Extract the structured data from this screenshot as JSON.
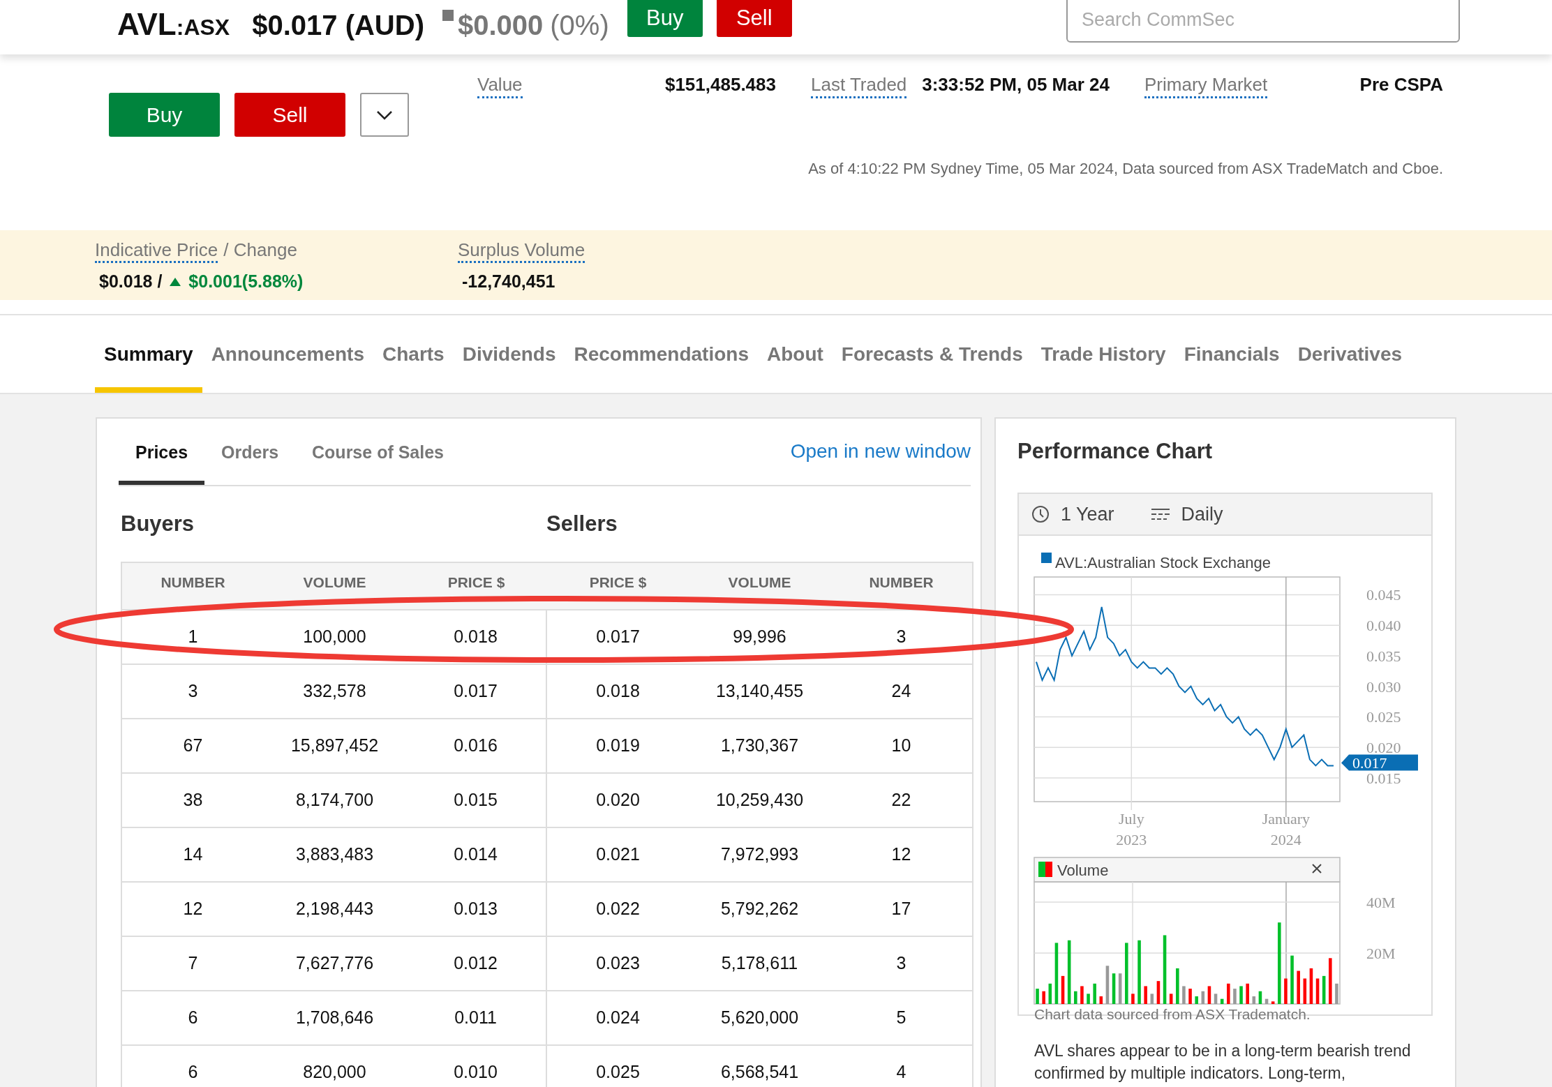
{
  "sticky_header": {
    "symbol": "AVL",
    "exchange": ":ASX",
    "price": "$0.017 (AUD)",
    "change": "$0.000",
    "change_pct": "(0%)",
    "buttons": [
      {
        "label": "Buy",
        "kind": "buy"
      },
      {
        "label": "Sell",
        "kind": "sell"
      }
    ],
    "search": {
      "placeholder": "Search CommSec"
    }
  },
  "actions": [
    {
      "label": "Buy",
      "kind": "buy"
    },
    {
      "label": "Sell",
      "kind": "sell"
    },
    {
      "kind": "menu"
    }
  ],
  "stats": [
    {
      "label": "Value",
      "value": "$151,485.483"
    },
    {
      "label": "Last Traded",
      "value": "3:33:52 PM, 05 Mar 24"
    },
    {
      "label": "Primary Market",
      "value": "Pre CSPA"
    }
  ],
  "as_of": "As of 4:10:22 PM Sydney Time, 05 Mar 2024, Data sourced from ASX TradeMatch and Cboe.",
  "auction": {
    "price_label": "Indicative Price",
    "change_label": "/ Change",
    "price": "$0.018 /",
    "change": "$0.001(5.88%)",
    "surplus_label": "Surplus Volume",
    "surplus": "-12,740,451"
  },
  "tabs": [
    {
      "label": "Summary",
      "selected": true
    },
    {
      "label": "Announcements",
      "selected": false
    },
    {
      "label": "Charts",
      "selected": false
    },
    {
      "label": "Dividends",
      "selected": false
    },
    {
      "label": "Recommendations",
      "selected": false
    },
    {
      "label": "About",
      "selected": false
    },
    {
      "label": "Forecasts & Trends",
      "selected": false
    },
    {
      "label": "Trade History",
      "selected": false
    },
    {
      "label": "Financials",
      "selected": false
    },
    {
      "label": "Derivatives",
      "selected": false
    }
  ],
  "depth": {
    "subtabs": [
      {
        "label": "Prices",
        "selected": true
      },
      {
        "label": "Orders",
        "selected": false
      },
      {
        "label": "Course of Sales",
        "selected": false
      }
    ],
    "open_link": "Open in new window",
    "buyers_title": "Buyers",
    "sellers_title": "Sellers",
    "columns": [
      "NUMBER",
      "VOLUME",
      "PRICE $",
      "PRICE $",
      "VOLUME",
      "NUMBER"
    ],
    "rows": [
      [
        "1",
        "100,000",
        "0.018",
        "0.017",
        "99,996",
        "3"
      ],
      [
        "3",
        "332,578",
        "0.017",
        "0.018",
        "13,140,455",
        "24"
      ],
      [
        "67",
        "15,897,452",
        "0.016",
        "0.019",
        "1,730,367",
        "10"
      ],
      [
        "38",
        "8,174,700",
        "0.015",
        "0.020",
        "10,259,430",
        "22"
      ],
      [
        "14",
        "3,883,483",
        "0.014",
        "0.021",
        "7,972,993",
        "12"
      ],
      [
        "12",
        "2,198,443",
        "0.013",
        "0.022",
        "5,792,262",
        "17"
      ],
      [
        "7",
        "7,627,776",
        "0.012",
        "0.023",
        "5,178,611",
        "3"
      ],
      [
        "6",
        "1,708,646",
        "0.011",
        "0.024",
        "5,620,000",
        "5"
      ],
      [
        "6",
        "820,000",
        "0.010",
        "0.025",
        "6,568,541",
        "4"
      ]
    ]
  },
  "annotation": {
    "kind": "ellipse",
    "color": "#ee3a33"
  },
  "performance": {
    "title": "Performance Chart",
    "period": "1 Year",
    "interval": "Daily",
    "last_price": "0.017",
    "chart_data": {
      "type": "line",
      "grid": true,
      "categories": [
        null,
        null,
        null,
        null,
        null,
        null,
        null,
        null,
        null,
        null,
        null,
        null,
        null,
        null,
        null,
        null,
        "July 2023",
        null,
        null,
        null,
        null,
        null,
        null,
        null,
        null,
        null,
        null,
        null,
        null,
        null,
        null,
        null,
        null,
        null,
        null,
        null,
        null,
        null,
        null,
        null,
        null,
        null,
        "January 2024",
        null,
        null,
        null,
        null,
        null,
        null,
        null,
        null
      ],
      "series": [
        {
          "name": "AVL:Australian Stock Exchange",
          "color": "#0a6eb4",
          "values": [
            0.034,
            0.031,
            0.033,
            0.031,
            0.036,
            0.038,
            0.035,
            0.037,
            0.039,
            0.036,
            0.038,
            0.043,
            0.038,
            0.037,
            0.035,
            0.036,
            0.034,
            0.033,
            0.034,
            0.033,
            0.033,
            0.032,
            0.033,
            0.032,
            0.03,
            0.029,
            0.03,
            0.028,
            0.027,
            0.028,
            0.026,
            0.027,
            0.025,
            0.024,
            0.025,
            0.023,
            0.022,
            0.023,
            0.022,
            0.02,
            0.018,
            0.02,
            0.023,
            0.02,
            0.021,
            0.022,
            0.018,
            0.017,
            0.018,
            0.017,
            0.017
          ]
        }
      ],
      "ylim": [
        0.0111,
        0.0479
      ],
      "yticks": [
        {
          "value": 0.045,
          "label": "0.045"
        },
        {
          "value": 0.04,
          "label": "0.040"
        },
        {
          "value": 0.035,
          "label": "0.035"
        },
        {
          "value": 0.03,
          "label": "0.030"
        },
        {
          "value": 0.025,
          "label": "0.025"
        },
        {
          "value": 0.02,
          "label": "0.020"
        },
        {
          "value": 0.015,
          "label": "0.015"
        }
      ]
    },
    "volume": {
      "legend": "Volume",
      "y_labels": [
        "40M",
        "20M"
      ]
    },
    "source": "Chart data sourced from ASX Tradematch.",
    "summary": "AVL shares appear to be in a long-term bearish trend confirmed by multiple indicators. Long-term,"
  }
}
